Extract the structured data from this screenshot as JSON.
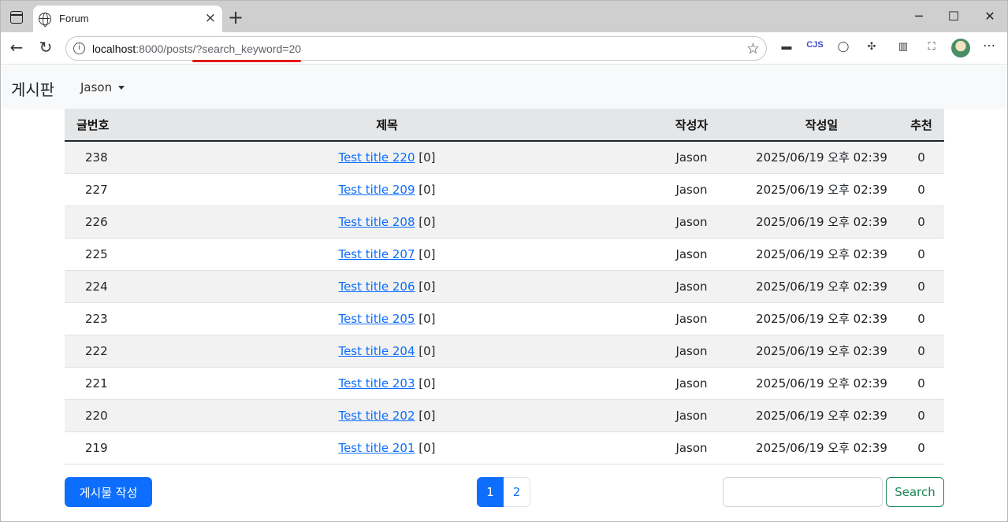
{
  "browser": {
    "tab_title": "Forum",
    "url_host": "localhost",
    "url_rest": ":8000/posts/?search_keyword=20",
    "window_controls": {
      "minimize": "─",
      "maximize": "☐",
      "close": "✕"
    }
  },
  "navbar": {
    "brand": "게시판",
    "user": "Jason"
  },
  "table": {
    "headers": {
      "num": "글번호",
      "title": "제목",
      "author": "작성자",
      "date": "작성일",
      "rec": "추천"
    },
    "rows": [
      {
        "num": "238",
        "title": "Test title 220",
        "comments": "[0]",
        "author": "Jason",
        "date": "2025/06/19 오후 02:39",
        "rec": "0"
      },
      {
        "num": "227",
        "title": "Test title 209",
        "comments": "[0]",
        "author": "Jason",
        "date": "2025/06/19 오후 02:39",
        "rec": "0"
      },
      {
        "num": "226",
        "title": "Test title 208",
        "comments": "[0]",
        "author": "Jason",
        "date": "2025/06/19 오후 02:39",
        "rec": "0"
      },
      {
        "num": "225",
        "title": "Test title 207",
        "comments": "[0]",
        "author": "Jason",
        "date": "2025/06/19 오후 02:39",
        "rec": "0"
      },
      {
        "num": "224",
        "title": "Test title 206",
        "comments": "[0]",
        "author": "Jason",
        "date": "2025/06/19 오후 02:39",
        "rec": "0"
      },
      {
        "num": "223",
        "title": "Test title 205",
        "comments": "[0]",
        "author": "Jason",
        "date": "2025/06/19 오후 02:39",
        "rec": "0"
      },
      {
        "num": "222",
        "title": "Test title 204",
        "comments": "[0]",
        "author": "Jason",
        "date": "2025/06/19 오후 02:39",
        "rec": "0"
      },
      {
        "num": "221",
        "title": "Test title 203",
        "comments": "[0]",
        "author": "Jason",
        "date": "2025/06/19 오후 02:39",
        "rec": "0"
      },
      {
        "num": "220",
        "title": "Test title 202",
        "comments": "[0]",
        "author": "Jason",
        "date": "2025/06/19 오후 02:39",
        "rec": "0"
      },
      {
        "num": "219",
        "title": "Test title 201",
        "comments": "[0]",
        "author": "Jason",
        "date": "2025/06/19 오후 02:39",
        "rec": "0"
      }
    ]
  },
  "controls": {
    "write_button": "게시물 작성",
    "pages": [
      "1",
      "2"
    ],
    "active_page": "1",
    "search_value": "",
    "search_button": "Search"
  },
  "colors": {
    "primary": "#0d6efd",
    "success": "#198754",
    "url_highlight": "#e31b1b"
  }
}
